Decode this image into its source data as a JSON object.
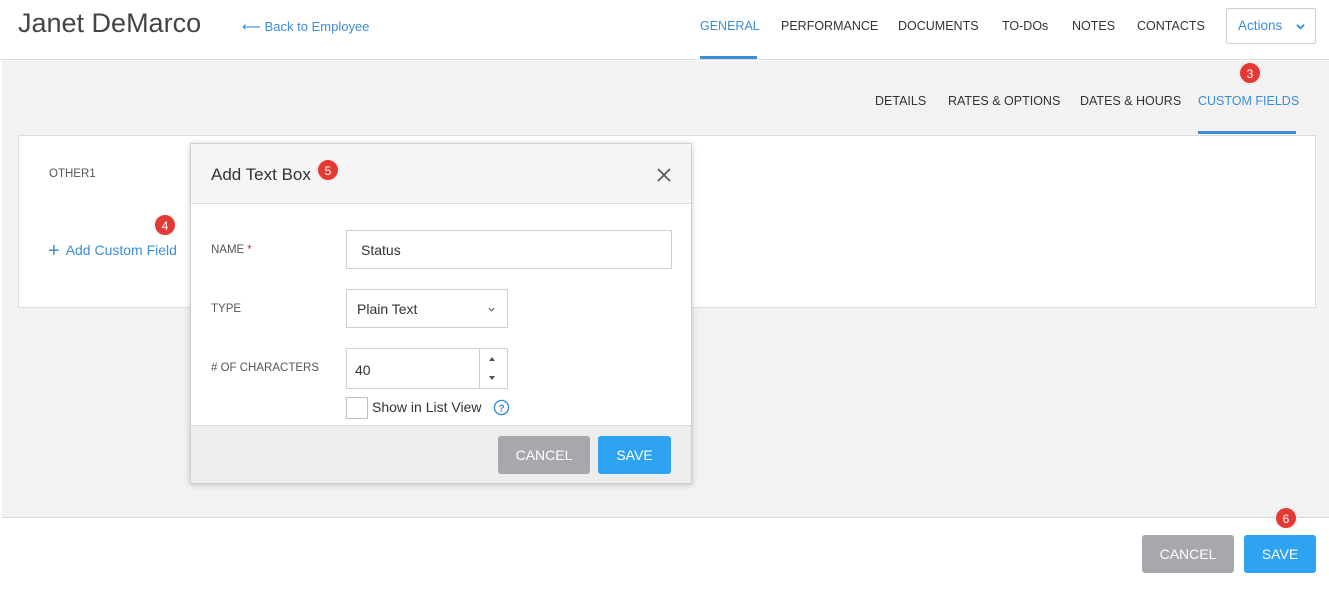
{
  "header": {
    "employee_name": "Janet DeMarco",
    "back_link": "Back to Employee",
    "tabs": [
      "GENERAL",
      "PERFORMANCE",
      "DOCUMENTS",
      "TO-DOs",
      "NOTES",
      "CONTACTS"
    ],
    "active_tab": "GENERAL",
    "actions_label": "Actions"
  },
  "sub_nav": {
    "tabs": [
      "DETAILS",
      "RATES & OPTIONS",
      "DATES & HOURS",
      "CUSTOM FIELDS"
    ],
    "active_tab": "CUSTOM FIELDS"
  },
  "panel": {
    "field_label": "OTHER1",
    "add_custom_field": "Add Custom Field"
  },
  "modal": {
    "title": "Add Text Box",
    "name_label": "NAME",
    "name_required": "*",
    "name_value": "Status",
    "type_label": "TYPE",
    "type_value": "Plain Text",
    "chars_label": "# OF CHARACTERS",
    "chars_value": "40",
    "show_in_list_label": "Show in List View",
    "show_in_list_checked": false,
    "cancel_label": "CANCEL",
    "save_label": "SAVE"
  },
  "footer": {
    "cancel_label": "CANCEL",
    "save_label": "SAVE"
  },
  "badges": {
    "b3": "3",
    "b4": "4",
    "b5": "5",
    "b6": "6"
  },
  "colors": {
    "accent": "#3c8dd6",
    "save_button": "#2ea3f2",
    "cancel_button": "#a6a8ab",
    "badge": "#e53935"
  },
  "icons": {
    "back": "arrow-left-icon",
    "actions": "chevron-down-icon",
    "add": "plus-icon",
    "close": "close-icon",
    "select": "chevron-down-icon",
    "spin_up": "caret-up-icon",
    "spin_down": "caret-down-icon",
    "help": "question-circle-icon"
  }
}
